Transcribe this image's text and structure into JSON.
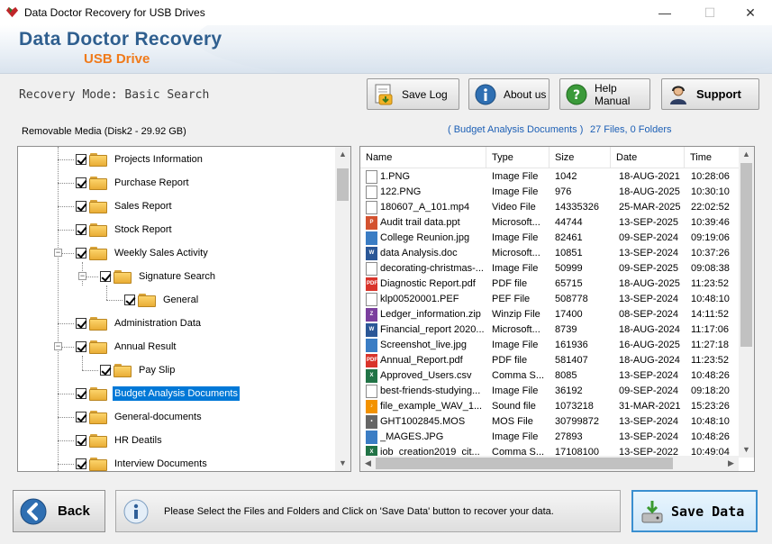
{
  "window": {
    "title": "Data Doctor Recovery for USB Drives",
    "minimize": "—",
    "maximize": "☐",
    "close": "✕"
  },
  "banner": {
    "title": "Data Doctor Recovery",
    "subtitle": "USB Drive"
  },
  "toolbar": {
    "mode": "Recovery Mode: Basic Search",
    "save_log": "Save Log",
    "about": "About us",
    "help": "Help Manual",
    "support": "Support"
  },
  "tree": {
    "media": "Removable Media (Disk2 - 29.92 GB)",
    "nodes": [
      {
        "label": "Projects Information"
      },
      {
        "label": "Purchase Report"
      },
      {
        "label": "Sales Report"
      },
      {
        "label": "Stock Report"
      },
      {
        "label": "Weekly Sales Activity"
      },
      {
        "label": "Signature Search"
      },
      {
        "label": "General"
      },
      {
        "label": "Administration Data"
      },
      {
        "label": "Annual Result"
      },
      {
        "label": "Pay Slip"
      },
      {
        "label": "Budget Analysis Documents"
      },
      {
        "label": "General-documents"
      },
      {
        "label": "HR Deatils"
      },
      {
        "label": "Interview Documents"
      }
    ]
  },
  "list": {
    "folder_name": "( Budget Analysis Documents )",
    "counts": "27 Files, 0 Folders",
    "columns": [
      "Name",
      "Type",
      "Size",
      "Date",
      "Time"
    ],
    "rows": [
      [
        "1.PNG",
        "Image File",
        "1042",
        "18-AUG-2021",
        "10:28:06"
      ],
      [
        "122.PNG",
        "Image File",
        "976",
        "18-AUG-2025",
        "10:30:10"
      ],
      [
        "180607_A_101.mp4",
        "Video File",
        "14335326",
        "25-MAR-2025",
        "22:02:52"
      ],
      [
        "Audit trail data.ppt",
        "Microsoft...",
        "44744",
        "13-SEP-2025",
        "10:39:46"
      ],
      [
        "College Reunion.jpg",
        "Image File",
        "82461",
        "09-SEP-2024",
        "09:19:06"
      ],
      [
        "data Analysis.doc",
        "Microsoft...",
        "10851",
        "13-SEP-2024",
        "10:37:26"
      ],
      [
        "decorating-christmas-...",
        "Image File",
        "50999",
        "09-SEP-2025",
        "09:08:38"
      ],
      [
        "Diagnostic Report.pdf",
        "PDF file",
        "65715",
        "18-AUG-2025",
        "11:23:52"
      ],
      [
        "klp00520001.PEF",
        "PEF File",
        "508778",
        "13-SEP-2024",
        "10:48:10"
      ],
      [
        "Ledger_information.zip",
        "Winzip File",
        "17400",
        "08-SEP-2024",
        "14:11:52"
      ],
      [
        "Financial_report 2020...",
        "Microsoft...",
        "8739",
        "18-AUG-2024",
        "11:17:06"
      ],
      [
        "Screenshot_live.jpg",
        "Image File",
        "161936",
        "16-AUG-2025",
        "11:27:18"
      ],
      [
        "Annual_Report.pdf",
        "PDF file",
        "581407",
        "18-AUG-2024",
        "11:23:52"
      ],
      [
        "Approved_Users.csv",
        "Comma S...",
        "8085",
        "13-SEP-2024",
        "10:48:26"
      ],
      [
        "best-friends-studying...",
        "Image File",
        "36192",
        "09-SEP-2024",
        "09:18:20"
      ],
      [
        "file_example_WAV_1...",
        "Sound file",
        "1073218",
        "31-MAR-2021",
        "15:23:26"
      ],
      [
        "GHT1002845.MOS",
        "MOS File",
        "30799872",
        "13-SEP-2024",
        "10:48:10"
      ],
      [
        "_MAGES.JPG",
        "Image File",
        "27893",
        "13-SEP-2024",
        "10:48:26"
      ],
      [
        "iob_creation2019_cit...",
        "Comma S...",
        "17108100",
        "13-SEP-2022",
        "10:49:04"
      ]
    ]
  },
  "footer": {
    "back": "Back",
    "message": "Please Select the Files and Folders and Click on 'Save Data' button to recover your data.",
    "save": "Save Data"
  }
}
